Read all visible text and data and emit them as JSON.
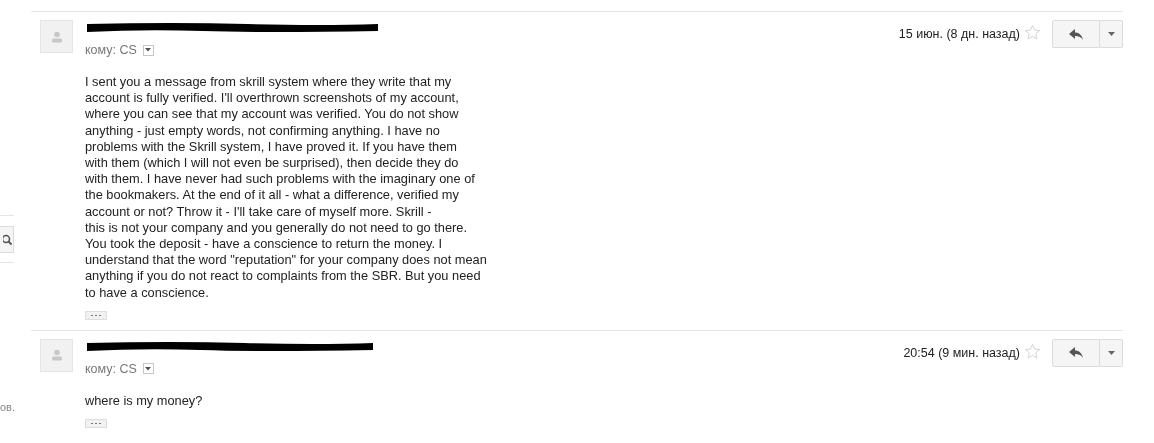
{
  "side_panel": {
    "fragment": "ов."
  },
  "messages": [
    {
      "recipient_label": "кому: CS",
      "date": "15 июн. (8 дн. назад)",
      "starred": false,
      "body": "I sent you a message from skrill system where they write that my\naccount is fully verified. I'll overthrown screenshots of my account,\nwhere you can see that my account was verified. You do not show\nanything - just empty words, not confirming anything. I have no\nproblems with the Skrill system, I have proved it. If you have them\nwith them (which I will not even be surprised), then decide they do\nwith them. I have never had such problems with the imaginary one of\nthe bookmakers. At the end of it all - what a difference, verified my\naccount or not? Throw it - I'll take care of myself more. Skrill -\nthis is not your company and you generally do not need to go there.\nYou took the deposit - have a conscience to return the money. I\nunderstand that the word \"reputation\" for your company does not mean\nanything if you do not react to complaints from the SBR. But you need\nto have a conscience."
    },
    {
      "recipient_label": "кому: CS",
      "date": "20:54 (9 мин. назад)",
      "starred": false,
      "body": "where is my money?"
    }
  ]
}
